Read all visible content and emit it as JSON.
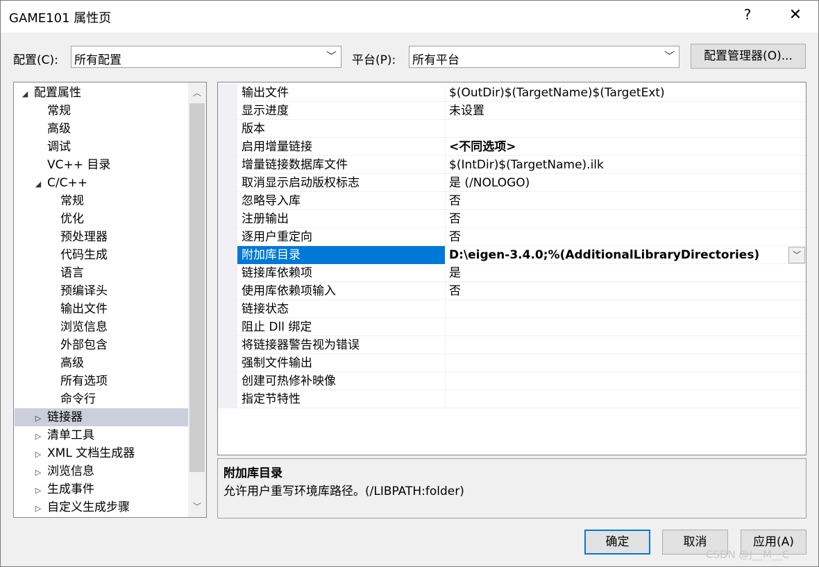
{
  "window": {
    "title": "GAME101 属性页",
    "help": "?",
    "close": "✕"
  },
  "config": {
    "config_label": "配置(C):",
    "config_value": "所有配置",
    "platform_label": "平台(P):",
    "platform_value": "所有平台",
    "manager_button": "配置管理器(O)..."
  },
  "tree": [
    {
      "label": "配置属性",
      "level": 0,
      "expander": "◢",
      "selected": false
    },
    {
      "label": "常规",
      "level": 1,
      "expander": "",
      "selected": false
    },
    {
      "label": "高级",
      "level": 1,
      "expander": "",
      "selected": false
    },
    {
      "label": "调试",
      "level": 1,
      "expander": "",
      "selected": false
    },
    {
      "label": "VC++ 目录",
      "level": 1,
      "expander": "",
      "selected": false
    },
    {
      "label": "C/C++",
      "level": 1,
      "expander": "◢",
      "selected": false
    },
    {
      "label": "常规",
      "level": 2,
      "expander": "",
      "selected": false
    },
    {
      "label": "优化",
      "level": 2,
      "expander": "",
      "selected": false
    },
    {
      "label": "预处理器",
      "level": 2,
      "expander": "",
      "selected": false
    },
    {
      "label": "代码生成",
      "level": 2,
      "expander": "",
      "selected": false
    },
    {
      "label": "语言",
      "level": 2,
      "expander": "",
      "selected": false
    },
    {
      "label": "预编译头",
      "level": 2,
      "expander": "",
      "selected": false
    },
    {
      "label": "输出文件",
      "level": 2,
      "expander": "",
      "selected": false
    },
    {
      "label": "浏览信息",
      "level": 2,
      "expander": "",
      "selected": false
    },
    {
      "label": "外部包含",
      "level": 2,
      "expander": "",
      "selected": false
    },
    {
      "label": "高级",
      "level": 2,
      "expander": "",
      "selected": false
    },
    {
      "label": "所有选项",
      "level": 2,
      "expander": "",
      "selected": false
    },
    {
      "label": "命令行",
      "level": 2,
      "expander": "",
      "selected": false
    },
    {
      "label": "链接器",
      "level": 1,
      "expander": "▷",
      "selected": true
    },
    {
      "label": "清单工具",
      "level": 1,
      "expander": "▷",
      "selected": false
    },
    {
      "label": "XML 文档生成器",
      "level": 1,
      "expander": "▷",
      "selected": false
    },
    {
      "label": "浏览信息",
      "level": 1,
      "expander": "▷",
      "selected": false
    },
    {
      "label": "生成事件",
      "level": 1,
      "expander": "▷",
      "selected": false
    },
    {
      "label": "自定义生成步骤",
      "level": 1,
      "expander": "▷",
      "selected": false
    }
  ],
  "properties": [
    {
      "name": "输出文件",
      "value": "$(OutDir)$(TargetName)$(TargetExt)",
      "bold": false,
      "selected": false
    },
    {
      "name": "显示进度",
      "value": "未设置",
      "bold": false,
      "selected": false
    },
    {
      "name": "版本",
      "value": "",
      "bold": false,
      "selected": false
    },
    {
      "name": "启用增量链接",
      "value": "<不同选项>",
      "bold": true,
      "selected": false
    },
    {
      "name": "增量链接数据库文件",
      "value": "$(IntDir)$(TargetName).ilk",
      "bold": false,
      "selected": false
    },
    {
      "name": "取消显示启动版权标志",
      "value": "是 (/NOLOGO)",
      "bold": false,
      "selected": false
    },
    {
      "name": "忽略导入库",
      "value": "否",
      "bold": false,
      "selected": false
    },
    {
      "name": "注册输出",
      "value": "否",
      "bold": false,
      "selected": false
    },
    {
      "name": "逐用户重定向",
      "value": "否",
      "bold": false,
      "selected": false
    },
    {
      "name": "附加库目录",
      "value": "D:\\eigen-3.4.0;%(AdditionalLibraryDirectories)",
      "bold": true,
      "selected": true
    },
    {
      "name": "链接库依赖项",
      "value": "是",
      "bold": false,
      "selected": false
    },
    {
      "name": "使用库依赖项输入",
      "value": "否",
      "bold": false,
      "selected": false
    },
    {
      "name": "链接状态",
      "value": "",
      "bold": false,
      "selected": false
    },
    {
      "name": "阻止 Dll 绑定",
      "value": "",
      "bold": false,
      "selected": false
    },
    {
      "name": "将链接器警告视为错误",
      "value": "",
      "bold": false,
      "selected": false
    },
    {
      "name": "强制文件输出",
      "value": "",
      "bold": false,
      "selected": false
    },
    {
      "name": "创建可热修补映像",
      "value": "",
      "bold": false,
      "selected": false
    },
    {
      "name": "指定节特性",
      "value": "",
      "bold": false,
      "selected": false
    }
  ],
  "description": {
    "title": "附加库目录",
    "text": "允许用户重写环境库路径。(/LIBPATH:folder)"
  },
  "buttons": {
    "ok": "确定",
    "cancel": "取消",
    "apply": "应用(A)"
  },
  "watermark": "CSDN @J__M__C",
  "icons": {
    "dropdown": "chevron-down-icon",
    "scroll_up": "scroll-up-icon",
    "scroll_down": "scroll-down-icon"
  }
}
